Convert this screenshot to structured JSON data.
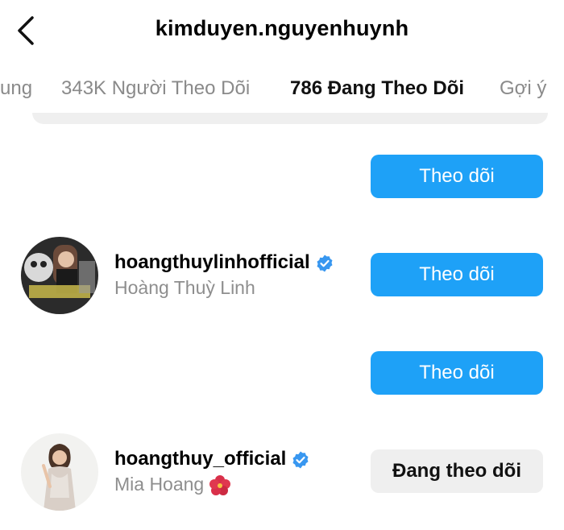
{
  "header": {
    "title": "kimduyen.nguyenhuynh"
  },
  "tabs": [
    {
      "label": "ung"
    },
    {
      "label": "343K Người Theo Dõi"
    },
    {
      "label": "786 Đang Theo Dõi"
    },
    {
      "label": "Gợi ý"
    }
  ],
  "rows": [
    {
      "username": "",
      "fullname": "",
      "button": "Theo dõi"
    },
    {
      "username": "hoangthuylinhofficial",
      "fullname": "Hoàng Thuỳ Linh",
      "button": "Theo dõi",
      "verified": true
    },
    {
      "username": "",
      "fullname": "",
      "button": "Theo dõi"
    },
    {
      "username": "hoangthuy_official",
      "fullname": "Mia Hoang",
      "button": "Đang theo dõi",
      "verified": true
    }
  ],
  "colors": {
    "follow_blue": "#1ea1f7",
    "verified_blue": "#3897f0",
    "following_gray": "#efefef"
  },
  "icons": [
    "back-arrow-icon",
    "verified-badge-icon",
    "hibiscus-flower-icon"
  ]
}
